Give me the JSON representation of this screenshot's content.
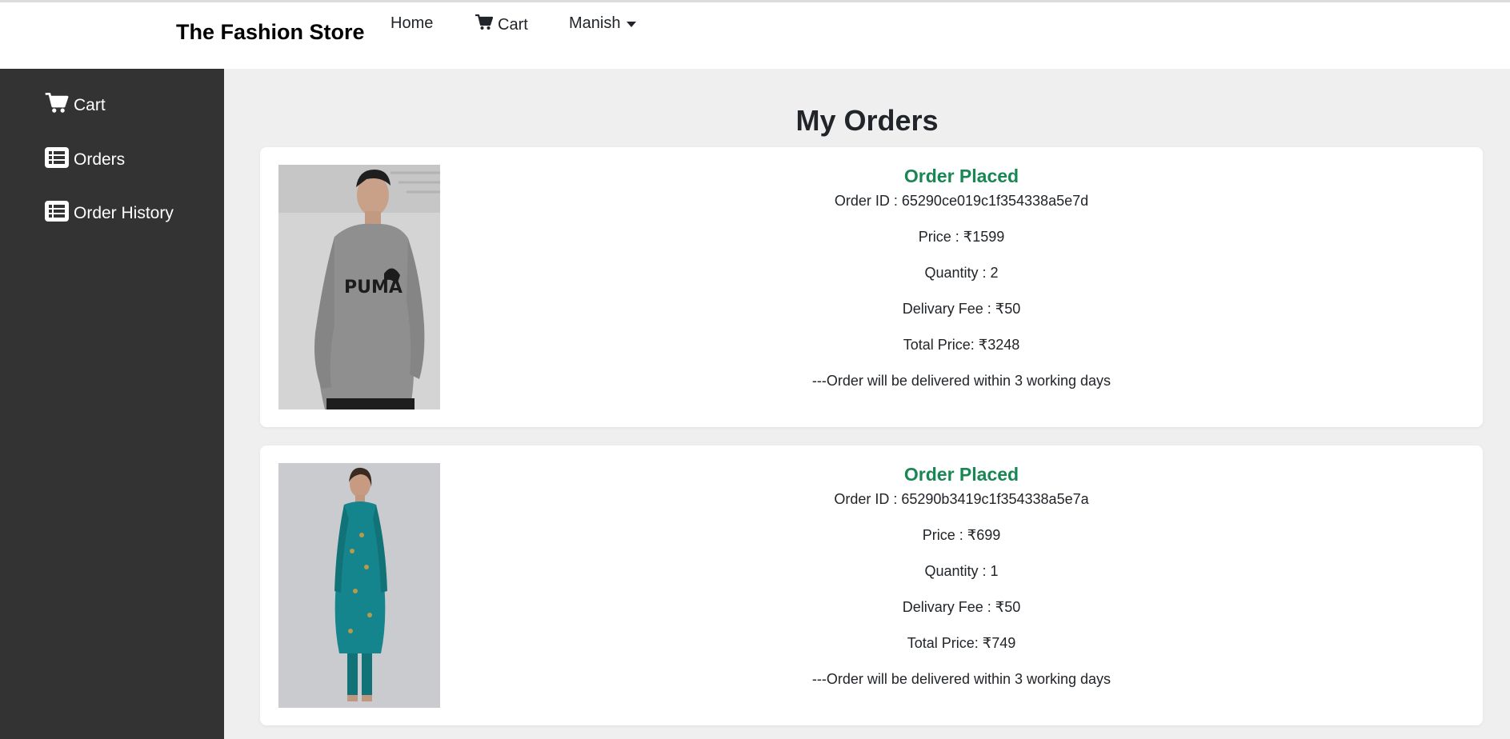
{
  "navbar": {
    "brand": "The Fashion Store",
    "home_label": "Home",
    "cart_label": "Cart",
    "user_label": "Manish"
  },
  "sidebar": {
    "items": [
      {
        "label": "Cart",
        "icon": "cart-icon"
      },
      {
        "label": "Orders",
        "icon": "list-icon"
      },
      {
        "label": "Order History",
        "icon": "list-icon"
      }
    ]
  },
  "main": {
    "title": "My Orders",
    "orders": [
      {
        "status": "Order Placed",
        "order_id": "Order ID : 65290ce019c1f354338a5e7d",
        "price": "Price : ₹1599",
        "quantity": "Quantity : 2",
        "delivery_fee": "Delivary Fee : ₹50",
        "total": "Total Price: ₹3248",
        "note": "---Order will be delivered within 3 working days",
        "image": "grey puma sweatshirt"
      },
      {
        "status": "Order Placed",
        "order_id": "Order ID : 65290b3419c1f354338a5e7a",
        "price": "Price : ₹699",
        "quantity": "Quantity : 1",
        "delivery_fee": "Delivary Fee : ₹50",
        "total": "Total Price: ₹749",
        "note": "---Order will be delivered within 3 working days",
        "image": "teal printed kurta set"
      }
    ]
  },
  "colors": {
    "sidebar_bg": "#333333",
    "page_bg": "#efefef",
    "status_green": "#198754"
  }
}
